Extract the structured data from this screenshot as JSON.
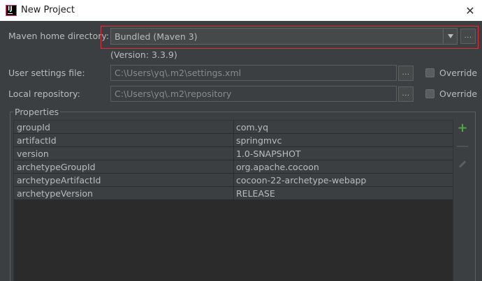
{
  "window": {
    "title": "New Project",
    "close_glyph": "✕"
  },
  "maven_home": {
    "label": "Maven home directory:",
    "value": "Bundled (Maven 3)",
    "version": "(Version: 3.3.9)",
    "browse_label": "..."
  },
  "user_settings": {
    "label": "User settings file:",
    "value": "C:\\Users\\yq\\.m2\\settings.xml",
    "browse_label": "...",
    "override_label": "Override",
    "override_checked": false
  },
  "local_repo": {
    "label": "Local repository:",
    "value": "C:\\Users\\yq\\.m2\\repository",
    "browse_label": "...",
    "override_label": "Override",
    "override_checked": false
  },
  "properties": {
    "title": "Properties",
    "rows": [
      {
        "key": "groupId",
        "value": "com.yq"
      },
      {
        "key": "artifactId",
        "value": "springmvc"
      },
      {
        "key": "version",
        "value": "1.0-SNAPSHOT"
      },
      {
        "key": "archetypeGroupId",
        "value": "org.apache.cocoon"
      },
      {
        "key": "archetypeArtifactId",
        "value": "cocoon-22-archetype-webapp"
      },
      {
        "key": "archetypeVersion",
        "value": "RELEASE"
      }
    ],
    "tools": {
      "add": "+",
      "remove": "—"
    }
  },
  "colors": {
    "highlight_border": "#e0303a",
    "add_icon": "#4ca844",
    "background": "#3c3f41"
  }
}
